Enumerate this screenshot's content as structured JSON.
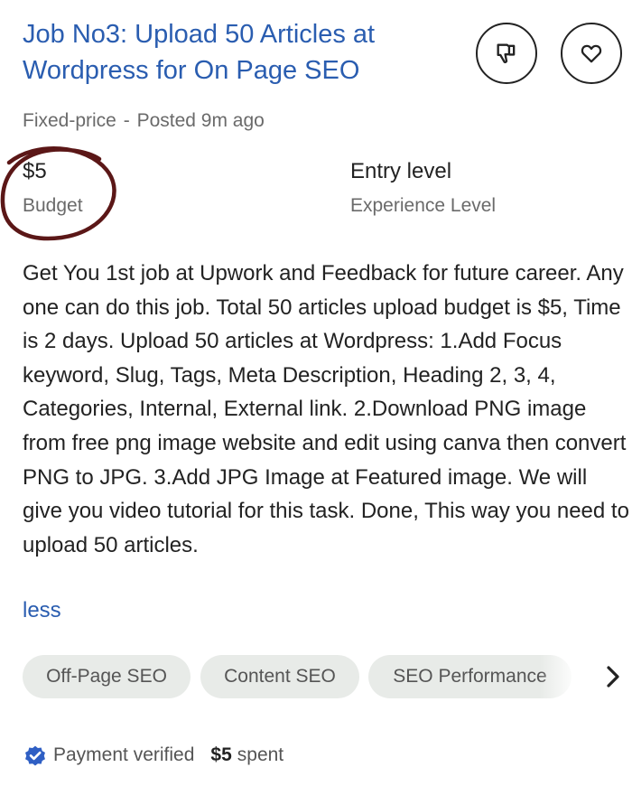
{
  "job": {
    "title": "Job No3: Upload 50 Articles at Wordpress for On Page SEO",
    "type": "Fixed-price",
    "separator": "-",
    "posted": "Posted 9m ago",
    "budget_value": "$5",
    "budget_label": "Budget",
    "level_value": "Entry level",
    "level_label": "Experience Level",
    "description": "Get You 1st job at Upwork and Feedback for future career. Any one can do this job. Total 50 articles upload budget is $5, Time is 2 days. Upload 50 articles at Wordpress: 1.Add Focus keyword, Slug, Tags, Meta Description, Heading 2, 3, 4, Categories, Internal, External link. 2.Download PNG image from free png image website and edit using canva then convert PNG to JPG. 3.Add JPG Image at Featured image. We will give you video tutorial for this task. Done, This way you need to upload 50 articles.",
    "less_label": "less"
  },
  "actions": {
    "dislike_icon": "thumbs-down-icon",
    "save_icon": "heart-icon"
  },
  "skills": [
    "Off-Page SEO",
    "Content SEO",
    "SEO Performance"
  ],
  "client": {
    "payment_status": "Payment verified",
    "spent_amount": "$5",
    "spent_label": "spent"
  },
  "colors": {
    "link_blue": "#2a5db0",
    "annotation_circle": "#5b1717",
    "verified_badge": "#2f5fc4",
    "chip_background": "#e8ebe8"
  }
}
